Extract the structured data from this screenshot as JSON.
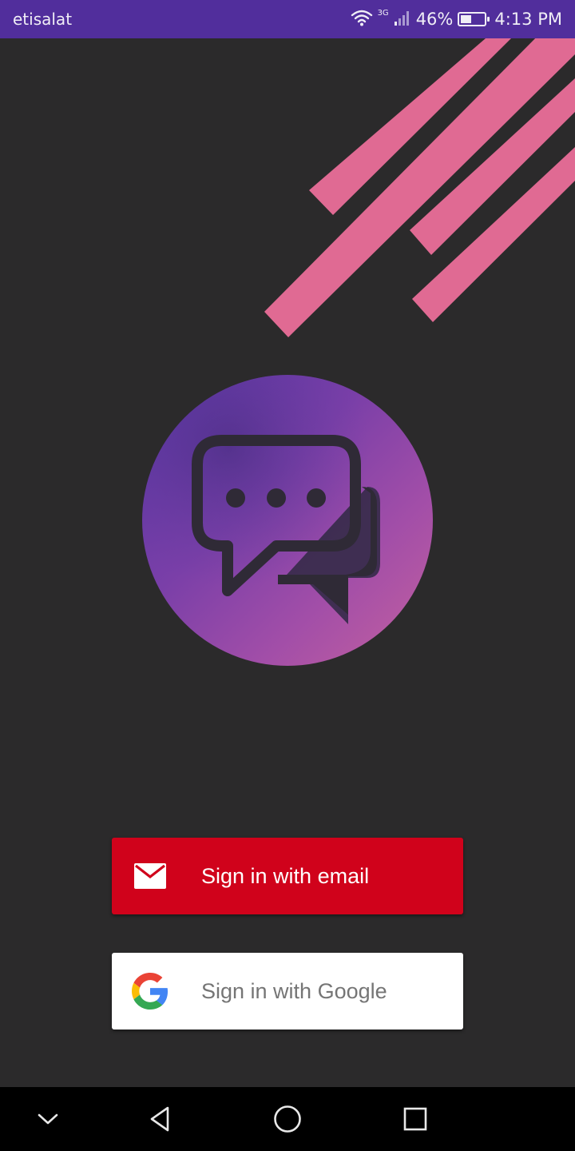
{
  "status_bar": {
    "carrier": "etisalat",
    "network_type": "3G",
    "battery_percent": "46%",
    "battery_level": 0.46,
    "time": "4:13 PM",
    "icons": [
      "wifi-icon",
      "signal-icon",
      "battery-icon"
    ]
  },
  "logo": {
    "icon": "chat-bubbles-icon"
  },
  "auth": {
    "email_label": "Sign in with email",
    "email_icon": "mail-icon",
    "google_label": "Sign in with Google",
    "google_icon": "google-g-icon"
  },
  "nav_bar": {
    "icons": [
      "collapse-chevron-icon",
      "back-icon",
      "home-icon",
      "recents-icon"
    ]
  },
  "colors": {
    "background": "#2b2a2b",
    "status_bar": "#512e9c",
    "stripe": "#e06a93",
    "email_button": "#d0021b",
    "google_button": "#ffffff",
    "logo_gradient_start": "#5a36a3",
    "logo_gradient_end": "#c5619f"
  }
}
